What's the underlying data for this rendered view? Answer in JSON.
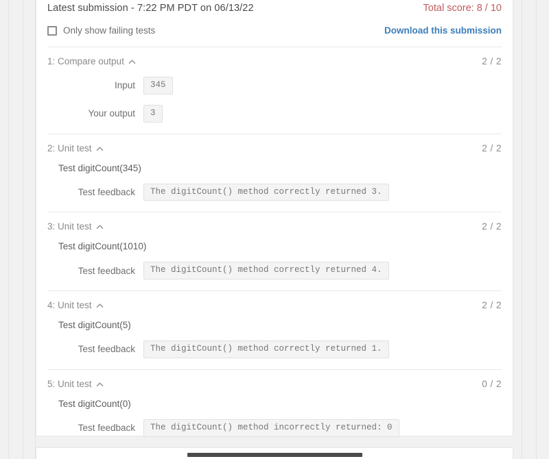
{
  "header": {
    "submission_title": "Latest submission - 7:22 PM PDT on 06/13/22",
    "total_score": "Total score: 8 / 10",
    "score_color": "#bf5b5b"
  },
  "filter": {
    "checkbox_label": "Only show failing tests",
    "checked": false,
    "download_label": "Download this submission",
    "link_color": "#3d7eba"
  },
  "tests": [
    {
      "title": "1: Compare output",
      "score": "2 / 2",
      "caret": "caret-up-icon",
      "rows": [
        {
          "key": "Input",
          "value": "345"
        },
        {
          "key": "Your output",
          "value": "3"
        }
      ]
    },
    {
      "title": "2: Unit test",
      "score": "2 / 2",
      "caret": "caret-up-icon",
      "description": "Test digitCount(345)",
      "rows": [
        {
          "key": "Test feedback",
          "value": "The digitCount() method correctly returned 3."
        }
      ]
    },
    {
      "title": "3: Unit test",
      "score": "2 / 2",
      "caret": "caret-up-icon",
      "description": "Test digitCount(1010)",
      "rows": [
        {
          "key": "Test feedback",
          "value": "The digitCount() method correctly returned 4."
        }
      ]
    },
    {
      "title": "4: Unit test",
      "score": "2 / 2",
      "caret": "caret-up-icon",
      "description": "Test digitCount(5)",
      "rows": [
        {
          "key": "Test feedback",
          "value": "The digitCount() method correctly returned 1."
        }
      ]
    },
    {
      "title": "5: Unit test",
      "score": "0 / 2",
      "caret": "caret-up-icon",
      "description": "Test digitCount(0)",
      "rows": [
        {
          "key": "Test feedback",
          "value": "The digitCount() method incorrectly returned: 0"
        }
      ]
    }
  ]
}
